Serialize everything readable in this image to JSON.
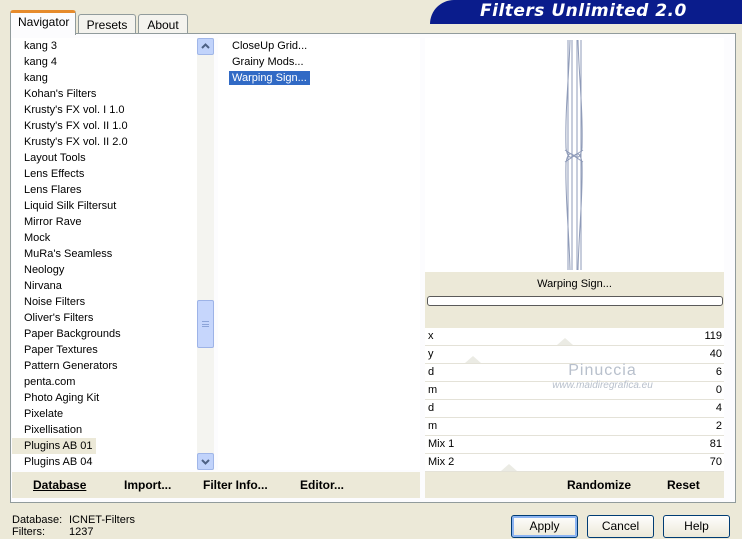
{
  "tabs": [
    {
      "label": "Navigator",
      "active": true
    },
    {
      "label": "Presets",
      "active": false
    },
    {
      "label": "About",
      "active": false
    }
  ],
  "banner": {
    "title": "Filters Unlimited 2.0",
    "color": "#0a1c8c"
  },
  "categories": {
    "items": [
      "kang 3",
      "kang 4",
      "kang",
      "Kohan's Filters",
      "Krusty's FX vol. I 1.0",
      "Krusty's FX vol. II 1.0",
      "Krusty's FX vol. II 2.0",
      "Layout Tools",
      "Lens Effects",
      "Lens Flares",
      "Liquid Silk Filtersut",
      "Mirror Rave",
      "Mock",
      "MuRa's Seamless",
      "Neology",
      "Nirvana",
      "Noise Filters",
      "Oliver's Filters",
      "Paper Backgrounds",
      "Paper Textures",
      "Pattern Generators",
      "penta.com",
      "Photo Aging Kit",
      "Pixelate",
      "Pixellisation",
      "Plugins AB 01",
      "Plugins AB 04"
    ],
    "selected": "Plugins AB 01",
    "scroll_up_icon": "scroll-up-arrow-icon",
    "scroll_down_icon": "scroll-down-arrow-icon"
  },
  "filters": {
    "items": [
      "CloseUp Grid...",
      "Grainy Mods...",
      "Warping Sign..."
    ],
    "selected": "Warping Sign..."
  },
  "preview": {
    "name": "Warping Sign...",
    "progress_fraction": 0
  },
  "params": [
    {
      "label": "x",
      "value": "119"
    },
    {
      "label": "y",
      "value": "40"
    },
    {
      "label": "d",
      "value": "6"
    },
    {
      "label": "m",
      "value": "0"
    },
    {
      "label": "d",
      "value": "4"
    },
    {
      "label": "m",
      "value": "2"
    },
    {
      "label": "Mix 1",
      "value": "81"
    },
    {
      "label": "Mix 2",
      "value": "70"
    }
  ],
  "watermark": {
    "line1": "Pinuccia",
    "line2": "www.maidiregrafica.eu"
  },
  "buttons_left": [
    {
      "label": "Database"
    },
    {
      "label": "Import..."
    },
    {
      "label": "Filter Info..."
    },
    {
      "label": "Editor..."
    }
  ],
  "buttons_right": {
    "randomize": "Randomize",
    "reset": "Reset"
  },
  "status": {
    "database_label": "Database:",
    "database_value": "ICNET-Filters",
    "filters_label": "Filters:",
    "filters_value": "1237"
  },
  "dialog": {
    "apply": "Apply",
    "cancel": "Cancel",
    "help": "Help"
  }
}
